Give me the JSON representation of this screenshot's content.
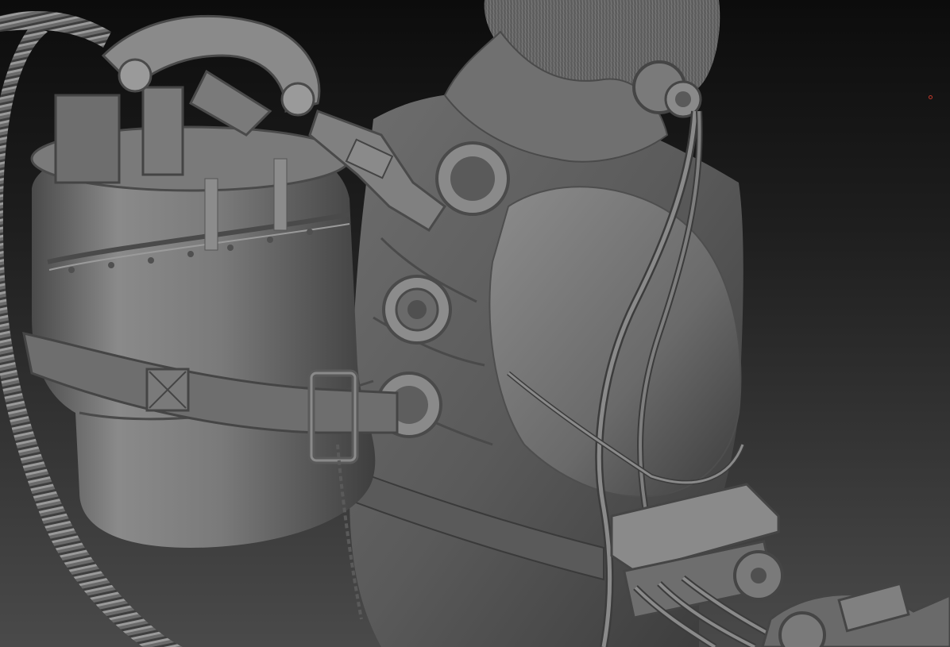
{
  "viewport": {
    "background_top": "#0c0c0c",
    "background_bottom": "#4a4a4a",
    "cursor_color": "#c0392b"
  },
  "model": {
    "base_color": "#7a7a7a",
    "shadow_color": "#3a3a3a",
    "highlight_color": "#b5b5b5",
    "parts": [
      "oxygen-tank",
      "tank-valve-assembly",
      "tank-strap",
      "strap-buckle",
      "ribbed-hose",
      "jacket-collar",
      "shoulder-ports",
      "headphone-ear",
      "coiled-cables",
      "mechanical-arm-joint"
    ]
  }
}
